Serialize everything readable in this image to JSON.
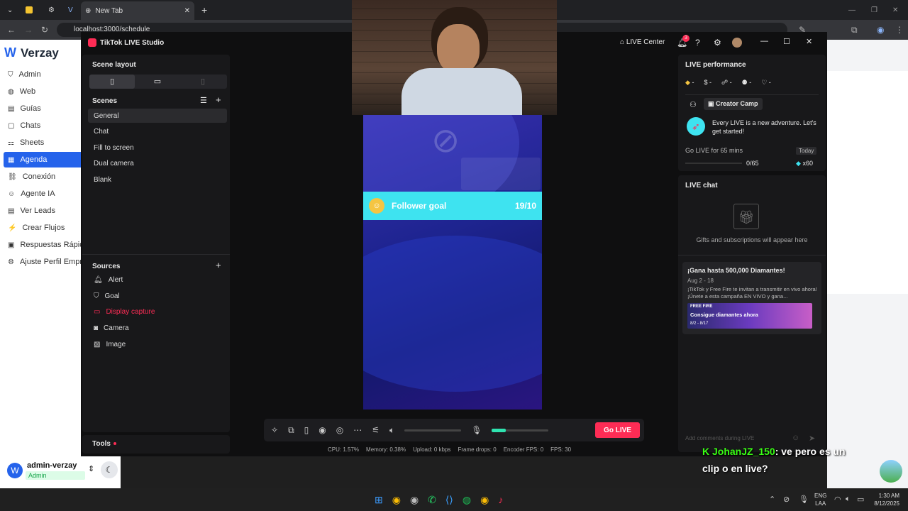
{
  "browser": {
    "tab_title": "New Tab",
    "url": "localhost:3000/schedule"
  },
  "verzay": {
    "brand": "Verzay",
    "items": [
      {
        "label": "Admin",
        "icon": "shield-icon"
      },
      {
        "label": "Web",
        "icon": "globe-icon"
      },
      {
        "label": "Guías",
        "icon": "book-icon"
      },
      {
        "label": "Chats",
        "icon": "chat-icon"
      },
      {
        "label": "Sheets",
        "icon": "sheet-icon"
      },
      {
        "label": "Agenda",
        "icon": "calendar-icon",
        "active": true
      },
      {
        "label": "Conexión",
        "icon": "link-icon"
      },
      {
        "label": "Agente IA",
        "icon": "bot-icon"
      },
      {
        "label": "Ver Leads",
        "icon": "table-icon"
      },
      {
        "label": "Crear Flujos",
        "icon": "flow-icon"
      },
      {
        "label": "Respuestas Rápidas",
        "icon": "zap-icon"
      },
      {
        "label": "Ajuste Perfil Empresa",
        "icon": "gear-icon"
      }
    ],
    "user": {
      "name": "admin-verzay",
      "role": "Admin"
    }
  },
  "tiktok": {
    "title": "TikTok LIVE Studio",
    "live_center": "LIVE Center",
    "notif_count": "3",
    "scene_layout": "Scene layout",
    "scenes_label": "Scenes",
    "scenes": [
      "General",
      "Chat",
      "Fill to screen",
      "Dual camera",
      "Blank"
    ],
    "sources_label": "Sources",
    "sources": [
      {
        "label": "Alert",
        "icon": "bell-icon"
      },
      {
        "label": "Goal",
        "icon": "shield-icon"
      },
      {
        "label": "Display capture",
        "icon": "monitor-icon",
        "warn": true
      },
      {
        "label": "Camera",
        "icon": "camera-icon"
      },
      {
        "label": "Image",
        "icon": "image-icon"
      }
    ],
    "tools": "Tools",
    "follower_goal": {
      "label": "Follower goal",
      "value": "19/10"
    },
    "go_live": "Go LIVE",
    "stats": [
      "CPU: 1.57%",
      "Memory: 0.38%",
      "Upload: 0 kbps",
      "Frame drops: 0",
      "Encoder FPS: 0",
      "FPS: 30"
    ],
    "perf": {
      "title": "LIVE performance",
      "metric_dash": "-",
      "creator_camp": "Creator Camp",
      "adventure": "Every LIVE is a new adventure. Let's get started!",
      "task": "Go LIVE for 65 mins",
      "today": "Today",
      "progress": "0/65",
      "progress_fraction": 0,
      "reward": "x60"
    },
    "chat": {
      "title": "LIVE chat",
      "empty": "Gifts and subscriptions will appear here",
      "placeholder": "Add comments during LIVE"
    },
    "promo": {
      "title": "¡Gana hasta 500,000 Diamantes!",
      "dates": "Aug 2 - 18",
      "body": "¡TikTok y Free Fire te invitan a transmitir en vivo ahora! ¡Únete a esta campaña EN VIVO y gana...",
      "banner_brand": "FREE FIRE",
      "banner_text": "Consigue diamantes ahora",
      "banner_dates": "8/2 - 8/17"
    }
  },
  "overlay": {
    "user": "JohanJZ_150",
    "msg1": ": ve pero es un",
    "msg2": "clip o en live?"
  },
  "taskbar": {
    "lang1": "ENG",
    "lang2": "LAA",
    "time": "1:30 AM",
    "date": "8/12/2025"
  }
}
